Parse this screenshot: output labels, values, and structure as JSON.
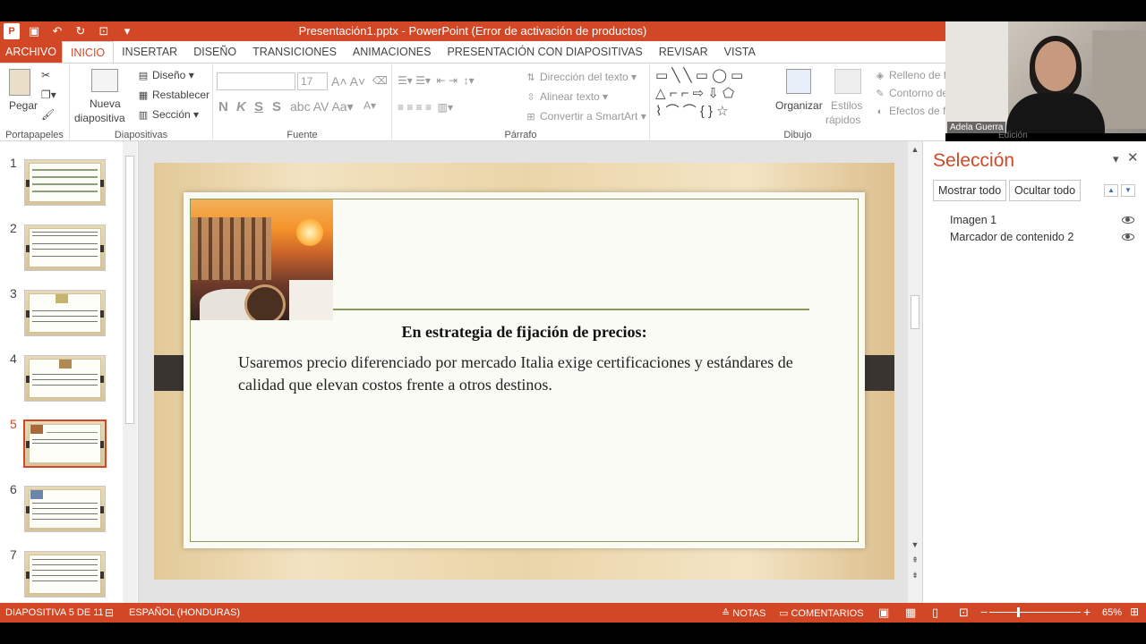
{
  "window": {
    "title": "Presentación1.pptx -  PowerPoint (Error de activación de productos)"
  },
  "tabs": [
    "ARCHIVO",
    "INICIO",
    "INSERTAR",
    "DISEÑO",
    "TRANSICIONES",
    "ANIMACIONES",
    "PRESENTACIÓN CON DIAPOSITIVAS",
    "REVISAR",
    "VISTA"
  ],
  "ribbon": {
    "clipboard": {
      "paste": "Pegar",
      "label": "Portapapeles"
    },
    "slides": {
      "new_slide_1": "Nueva",
      "new_slide_2": "diapositiva",
      "layout": "Diseño",
      "reset": "Restablecer",
      "section": "Sección",
      "label": "Diapositivas"
    },
    "font": {
      "size": "17",
      "bold": "N",
      "italic": "K",
      "underline": "S",
      "strike": "S",
      "label": "Fuente"
    },
    "paragraph": {
      "text_direction": "Dirección del texto",
      "align_text": "Alinear texto",
      "smartart": "Convertir a SmartArt",
      "label": "Párrafo"
    },
    "drawing": {
      "arrange": "Organizar",
      "quick_styles_1": "Estilos",
      "quick_styles_2": "rápidos",
      "fill": "Relleno de fo",
      "outline": "Contorno de",
      "effects": "Efectos de fo",
      "label": "Dibujo"
    }
  },
  "webcam": {
    "name": "Adela Guerra",
    "edicion": "Edición"
  },
  "thumbnails": [
    "1",
    "2",
    "3",
    "4",
    "5",
    "6",
    "7"
  ],
  "slide": {
    "heading": "En estrategia de fijación de precios:",
    "body": "Usaremos precio diferenciado por mercado  Italia exige certificaciones y estándares de calidad que elevan costos frente a otros destinos."
  },
  "selection_pane": {
    "title": "Selección",
    "show_all": "Mostrar todo",
    "hide_all": "Ocultar todo",
    "items": [
      "Imagen 1",
      "Marcador de contenido 2"
    ]
  },
  "status": {
    "slide_of": "DIAPOSITIVA 5 DE 11",
    "language": "ESPAÑOL (HONDURAS)",
    "notes": "NOTAS",
    "comments": "COMENTARIOS",
    "zoom": "65%"
  }
}
